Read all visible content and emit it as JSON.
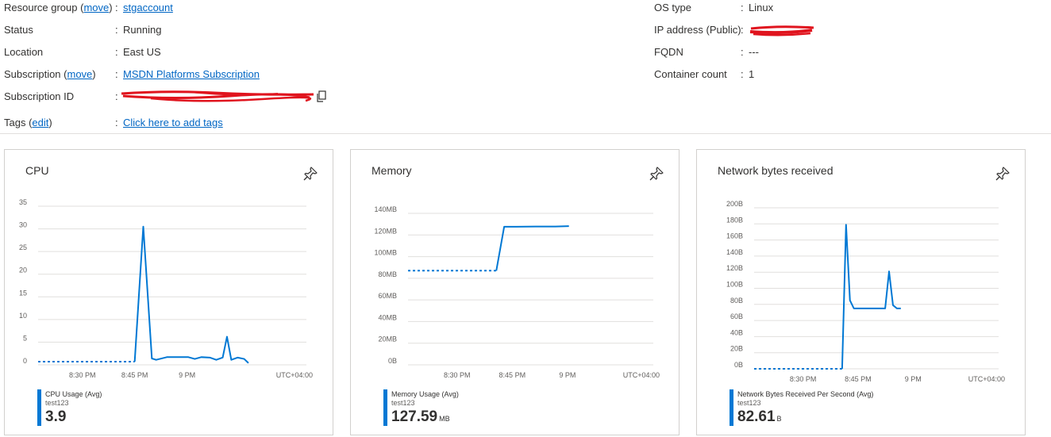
{
  "properties": {
    "resource_group": {
      "label": "Resource group",
      "link": "move",
      "value": "stgaccount"
    },
    "status": {
      "label": "Status",
      "value": "Running"
    },
    "location": {
      "label": "Location",
      "value": "East US"
    },
    "subscription": {
      "label": "Subscription",
      "link": "move",
      "value": "MSDN Platforms Subscription"
    },
    "subscription_id": {
      "label": "Subscription ID"
    },
    "tags": {
      "label": "Tags",
      "link": "edit",
      "value": "Click here to add tags"
    },
    "os_type": {
      "label": "OS type",
      "value": "Linux"
    },
    "ip_address": {
      "label": "IP address (Public)"
    },
    "fqdn": {
      "label": "FQDN",
      "value": "---"
    },
    "container_count": {
      "label": "Container count",
      "value": "1"
    },
    "colon": ":"
  },
  "colors": {
    "accent": "#0078d4",
    "link": "#0066c4",
    "redaction": "#e0141e"
  },
  "chart_data": [
    {
      "type": "line",
      "title": "CPU",
      "x_ticks": [
        "8:30 PM",
        "8:45 PM",
        "9 PM"
      ],
      "timezone": "UTC+04:00",
      "y_ticks": [
        "0",
        "5",
        "10",
        "15",
        "20",
        "25",
        "30",
        "35"
      ],
      "ylim": [
        0,
        35
      ],
      "x_range_min": [
        0,
        125
      ],
      "series": [
        {
          "name": "CPU Usage (Avg)",
          "resource": "test123",
          "dashed_until": 45,
          "points": [
            [
              0,
              0.7
            ],
            [
              45,
              0.7
            ],
            [
              49,
              30.5
            ],
            [
              53,
              1.4
            ],
            [
              55,
              1.1
            ],
            [
              60,
              1.7
            ],
            [
              65,
              1.7
            ],
            [
              70,
              1.7
            ],
            [
              73,
              1.3
            ],
            [
              76,
              1.7
            ],
            [
              80,
              1.6
            ],
            [
              83,
              1.1
            ],
            [
              86,
              1.6
            ],
            [
              88,
              6.2
            ],
            [
              90,
              1.1
            ],
            [
              93,
              1.6
            ],
            [
              96,
              1.3
            ],
            [
              98,
              0.4
            ]
          ]
        }
      ],
      "summary_value": "3.9",
      "summary_unit": ""
    },
    {
      "type": "line",
      "title": "Memory",
      "x_ticks": [
        "8:30 PM",
        "8:45 PM",
        "9 PM"
      ],
      "timezone": "UTC+04:00",
      "y_ticks": [
        "0B",
        "20MB",
        "40MB",
        "60MB",
        "80MB",
        "100MB",
        "120MB",
        "140MB"
      ],
      "ylim": [
        0,
        140
      ],
      "x_range_min": [
        0,
        125
      ],
      "series": [
        {
          "name": "Memory Usage (Avg)",
          "resource": "test123",
          "dashed_until": 45,
          "points": [
            [
              0,
              87
            ],
            [
              45,
              87
            ],
            [
              49,
              127.6
            ],
            [
              55,
              127.6
            ],
            [
              65,
              127.8
            ],
            [
              75,
              127.8
            ],
            [
              82,
              128.2
            ]
          ]
        }
      ],
      "summary_value": "127.59",
      "summary_unit": "MB"
    },
    {
      "type": "line",
      "title": "Network bytes received",
      "x_ticks": [
        "8:30 PM",
        "8:45 PM",
        "9 PM"
      ],
      "timezone": "UTC+04:00",
      "y_ticks": [
        "0B",
        "20B",
        "40B",
        "60B",
        "80B",
        "100B",
        "120B",
        "140B",
        "160B",
        "180B",
        "200B"
      ],
      "ylim": [
        0,
        200
      ],
      "x_range_min": [
        0,
        125
      ],
      "series": [
        {
          "name": "Network Bytes Received Per Second (Avg)",
          "resource": "test123",
          "dashed_until": 45,
          "points": [
            [
              0,
              0
            ],
            [
              45,
              0
            ],
            [
              47,
              179
            ],
            [
              49,
              85
            ],
            [
              51,
              75
            ],
            [
              55,
              75
            ],
            [
              60,
              75
            ],
            [
              65,
              75
            ],
            [
              67,
              75
            ],
            [
              69,
              121
            ],
            [
              71,
              79
            ],
            [
              73,
              75
            ],
            [
              75,
              75
            ]
          ]
        }
      ],
      "summary_value": "82.61",
      "summary_unit": "B"
    }
  ]
}
